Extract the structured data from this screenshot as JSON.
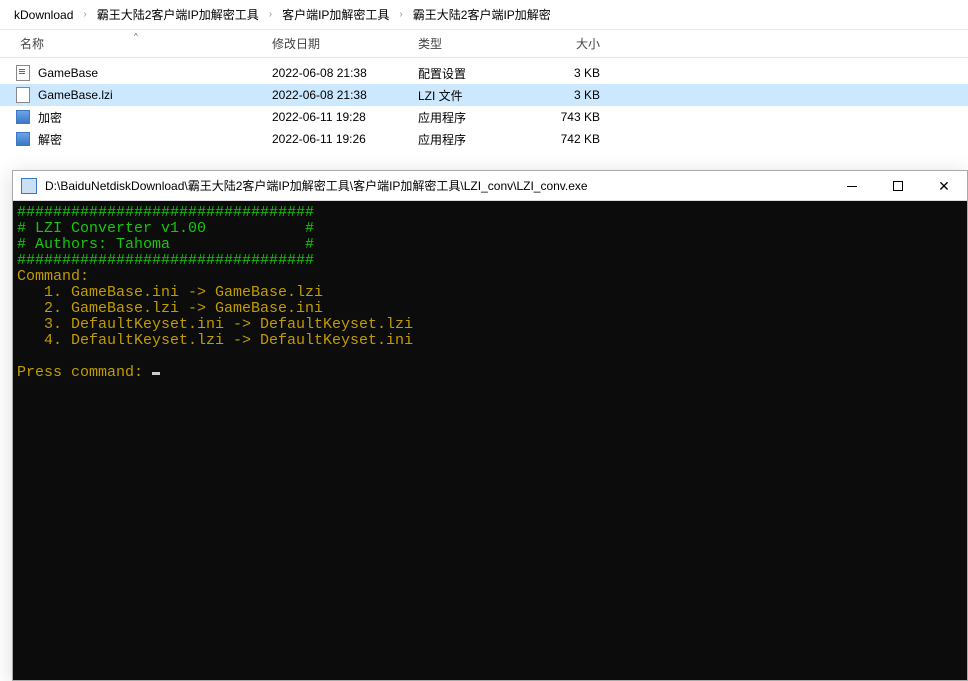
{
  "breadcrumb": {
    "items": [
      {
        "label": "kDownload"
      },
      {
        "label": "霸王大陆2客户端IP加解密工具"
      },
      {
        "label": "客户端IP加解密工具"
      },
      {
        "label": "霸王大陆2客户端IP加解密"
      }
    ],
    "sep": "›"
  },
  "columns": {
    "name": "名称",
    "date": "修改日期",
    "type": "类型",
    "size": "大小",
    "sort_arrow": "^"
  },
  "files": [
    {
      "icon": "ini",
      "name": "GameBase",
      "date": "2022-06-08 21:38",
      "type": "配置设置",
      "size": "3 KB",
      "selected": false
    },
    {
      "icon": "lzi",
      "name": "GameBase.lzi",
      "date": "2022-06-08 21:38",
      "type": "LZI 文件",
      "size": "3 KB",
      "selected": true
    },
    {
      "icon": "exe",
      "name": "加密",
      "date": "2022-06-11 19:28",
      "type": "应用程序",
      "size": "743 KB",
      "selected": false
    },
    {
      "icon": "exe",
      "name": "解密",
      "date": "2022-06-11 19:26",
      "type": "应用程序",
      "size": "742 KB",
      "selected": false
    }
  ],
  "console": {
    "title": "D:\\BaiduNetdiskDownload\\霸王大陆2客户端IP加解密工具\\客户端IP加解密工具\\LZI_conv\\LZI_conv.exe",
    "banner_border": "#################################",
    "banner_title": "# LZI Converter v1.00           #",
    "banner_author": "# Authors: Tahoma               #",
    "command_label": "Command:",
    "commands": [
      "   1. GameBase.ini -> GameBase.lzi",
      "   2. GameBase.lzi -> GameBase.ini",
      "   3. DefaultKeyset.ini -> DefaultKeyset.lzi",
      "   4. DefaultKeyset.lzi -> DefaultKeyset.ini"
    ],
    "prompt": "Press command: "
  }
}
